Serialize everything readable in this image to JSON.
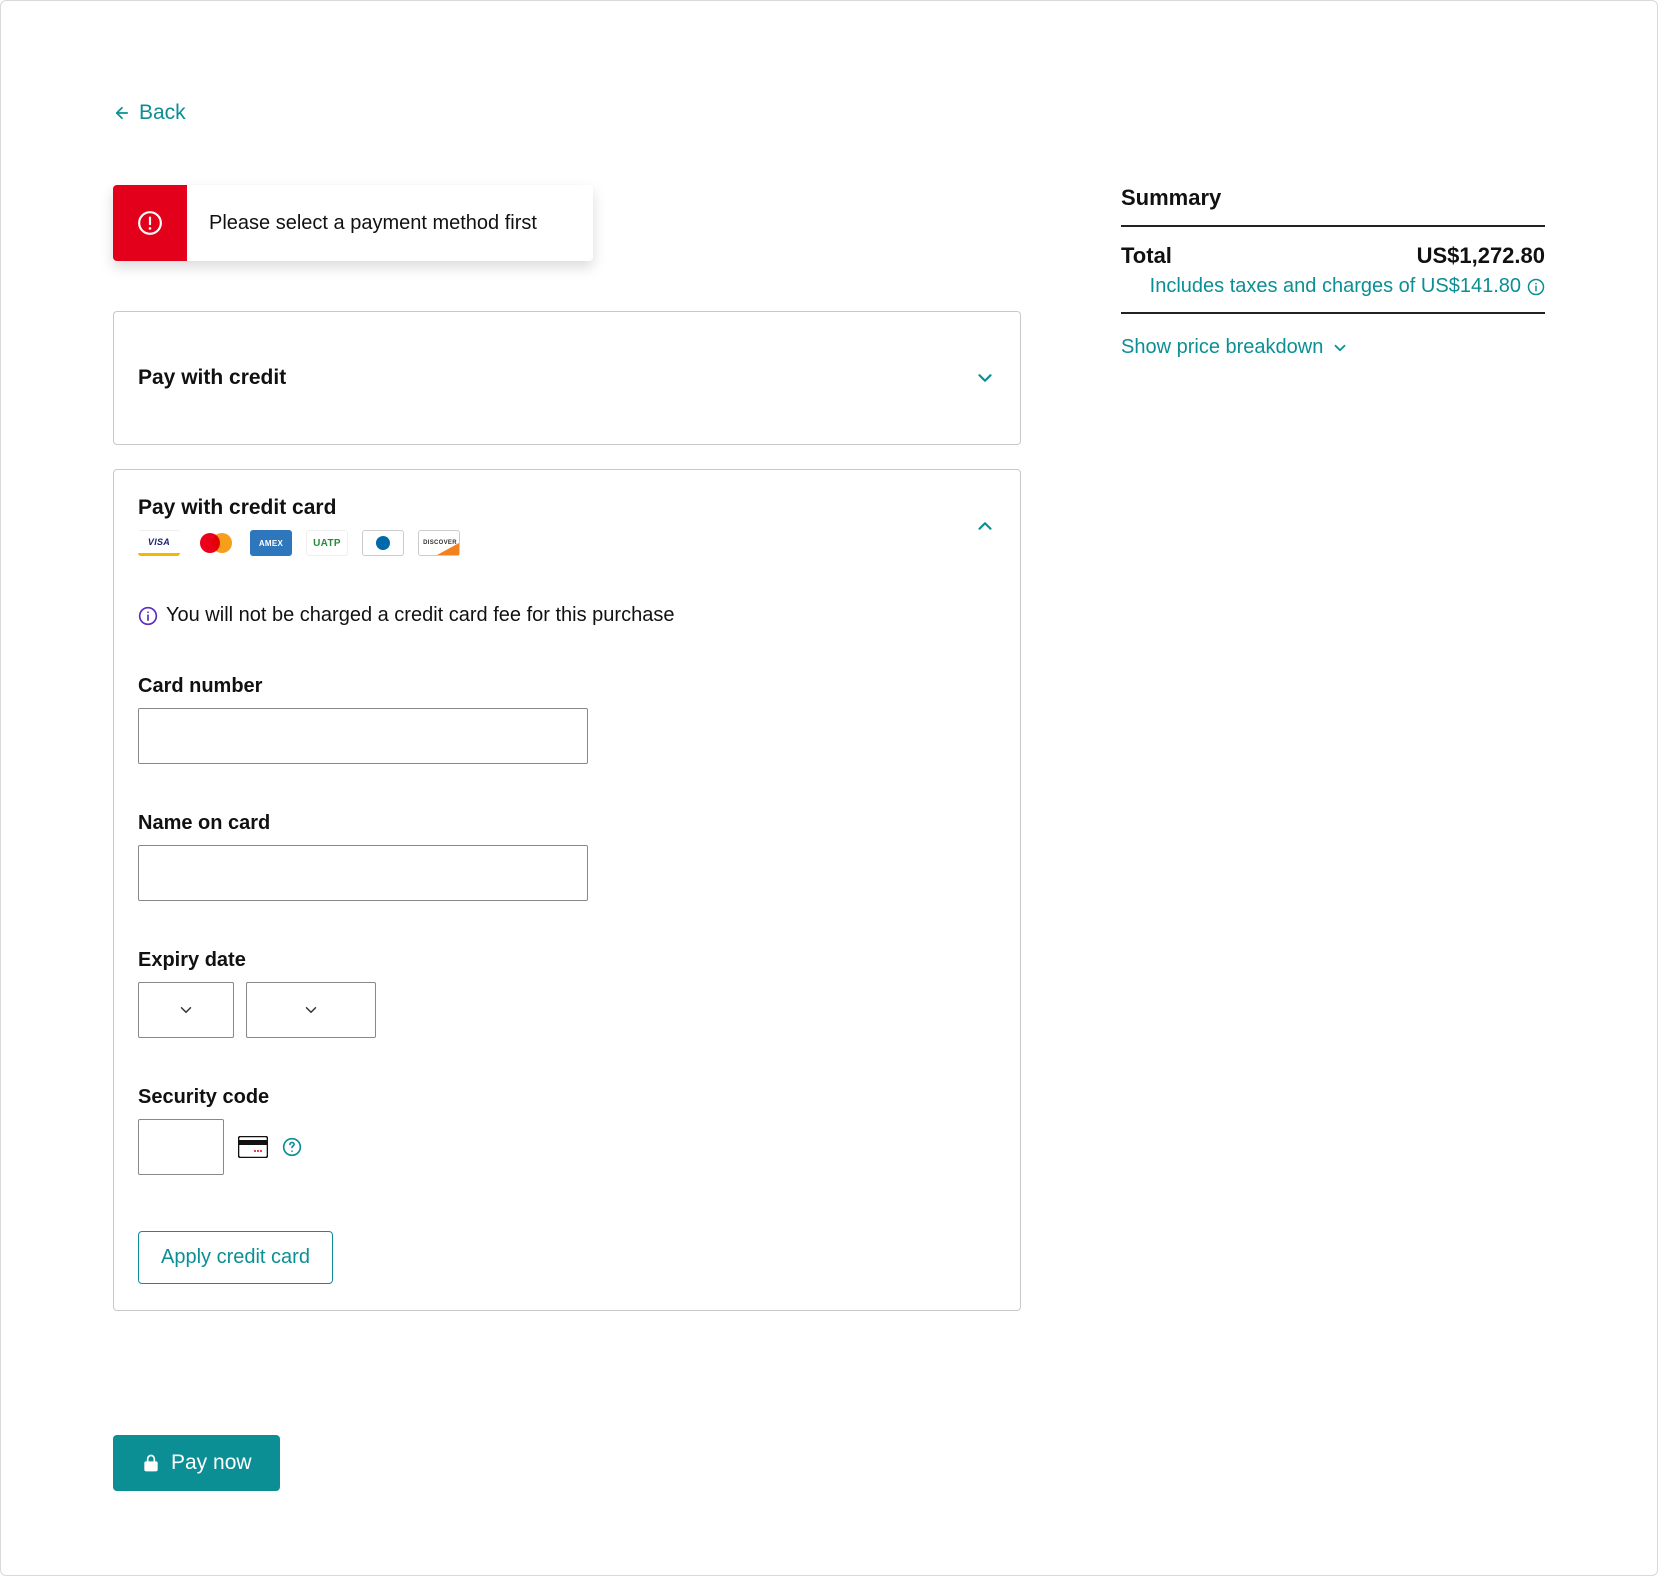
{
  "nav": {
    "back_label": "Back"
  },
  "error": {
    "message": "Please select a payment method first"
  },
  "panels": {
    "pay_credit_title": "Pay with credit",
    "pay_card_title": "Pay with credit card",
    "fee_note": "You will not be charged a credit card fee for this purchase"
  },
  "card_brands": [
    "visa",
    "mastercard",
    "amex",
    "uatp",
    "diners",
    "discover"
  ],
  "form": {
    "card_number_label": "Card number",
    "name_label": "Name on card",
    "expiry_label": "Expiry date",
    "cvv_label": "Security code",
    "apply_label": "Apply credit card"
  },
  "actions": {
    "pay_label": "Pay now"
  },
  "summary": {
    "title": "Summary",
    "total_label": "Total",
    "total_value": "US$1,272.80",
    "taxes_text": "Includes taxes and charges of US$141.80",
    "breakdown_label": "Show price breakdown"
  }
}
